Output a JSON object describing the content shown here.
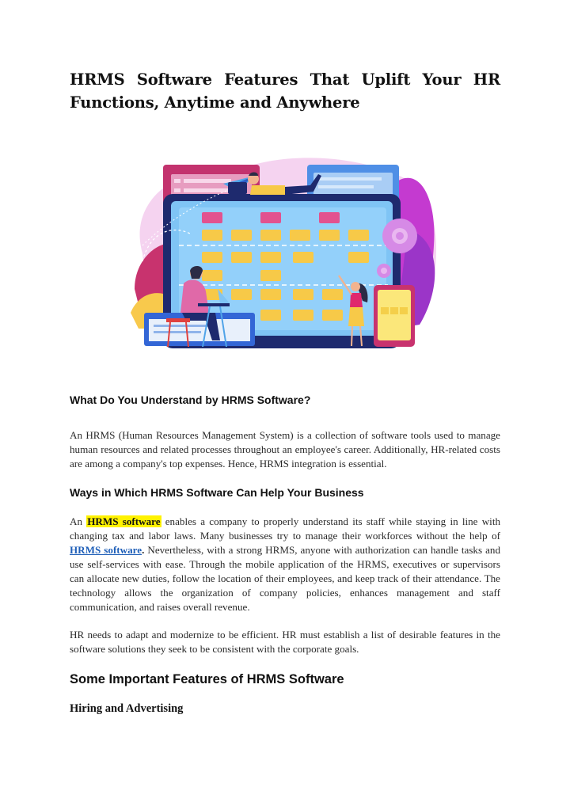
{
  "document": {
    "title_line1": "HRMS Software Features That Uplift Your HR",
    "title_line2": "Functions, Anytime and Anywhere",
    "hero_image": {
      "description": "HR management illustration: large monitor with grid of yellow folders and pink cards, man at laptop, woman pointing, person lying on monitor top, gears, paper plane, tablet",
      "colors": {
        "screen": "#7fc4f5",
        "frame": "#1e2a6e",
        "folder": "#f7c948",
        "card_pink": "#e2528f",
        "blob": "#f3c6ec",
        "purple_leaf": "#b23fd0"
      }
    },
    "sections": [
      {
        "heading": "What Do You Understand by HRMS Software?",
        "paragraphs": [
          "An HRMS (Human Resources Management System) is a collection of software tools used to manage human resources and related processes throughout an employee's career. Additionally, HR-related costs are among a company's top expenses. Hence, HRMS integration is essential."
        ]
      },
      {
        "heading": "Ways in Which HRMS Software Can Help Your Business",
        "p2_prefix": "An ",
        "p2_highlight": "HRMS software",
        "p2_mid": " enables a company to properly understand its staff while staying in line with changing tax and labor laws. Many businesses try to manage their workforces without the help of ",
        "p2_link": "HRMS software",
        "p2_link_dot": ".",
        "p2_rest": " Nevertheless, with a strong HRMS, anyone with authorization can handle tasks and use self-services with ease. Through the mobile application of the HRMS, executives or supervisors can allocate new duties, follow the location of their employees, and keep track of their attendance. The technology allows the organization of company policies, enhances management and staff communication, and raises overall revenue.",
        "p3": "HR needs to adapt and modernize to be efficient. HR must establish a list of desirable features in the software solutions they seek to be consistent with the corporate goals."
      },
      {
        "heading": "Some Important Features of HRMS Software",
        "subheading": "Hiring and Advertising"
      }
    ],
    "colors": {
      "highlight": "#fff200",
      "link": "#1f5fb8",
      "text": "#2a2a2a"
    }
  }
}
